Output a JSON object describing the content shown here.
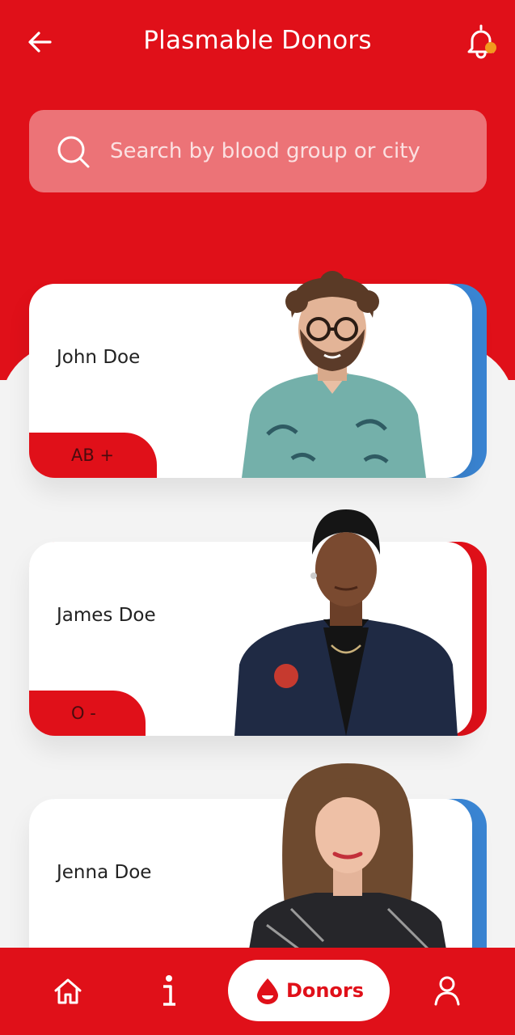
{
  "header": {
    "title": "Plasmable Donors"
  },
  "search": {
    "placeholder": "Search by blood group or city"
  },
  "donors": [
    {
      "name": "John Doe",
      "blood_group": "AB +",
      "accent_color": "#3a85d3"
    },
    {
      "name": "James Doe",
      "blood_group": "O -",
      "accent_color": "#e01019"
    },
    {
      "name": "Jenna Doe",
      "blood_group": "",
      "accent_color": "#3a85d3"
    }
  ],
  "nav": {
    "items": [
      {
        "icon": "home-icon"
      },
      {
        "icon": "info-icon"
      },
      {
        "icon": "blood-drop-icon",
        "label": "Donors",
        "active": true
      },
      {
        "icon": "user-icon"
      }
    ]
  },
  "colors": {
    "primary": "#e01019",
    "search_bg": "#ec7377",
    "notification_dot": "#f29a1e"
  }
}
